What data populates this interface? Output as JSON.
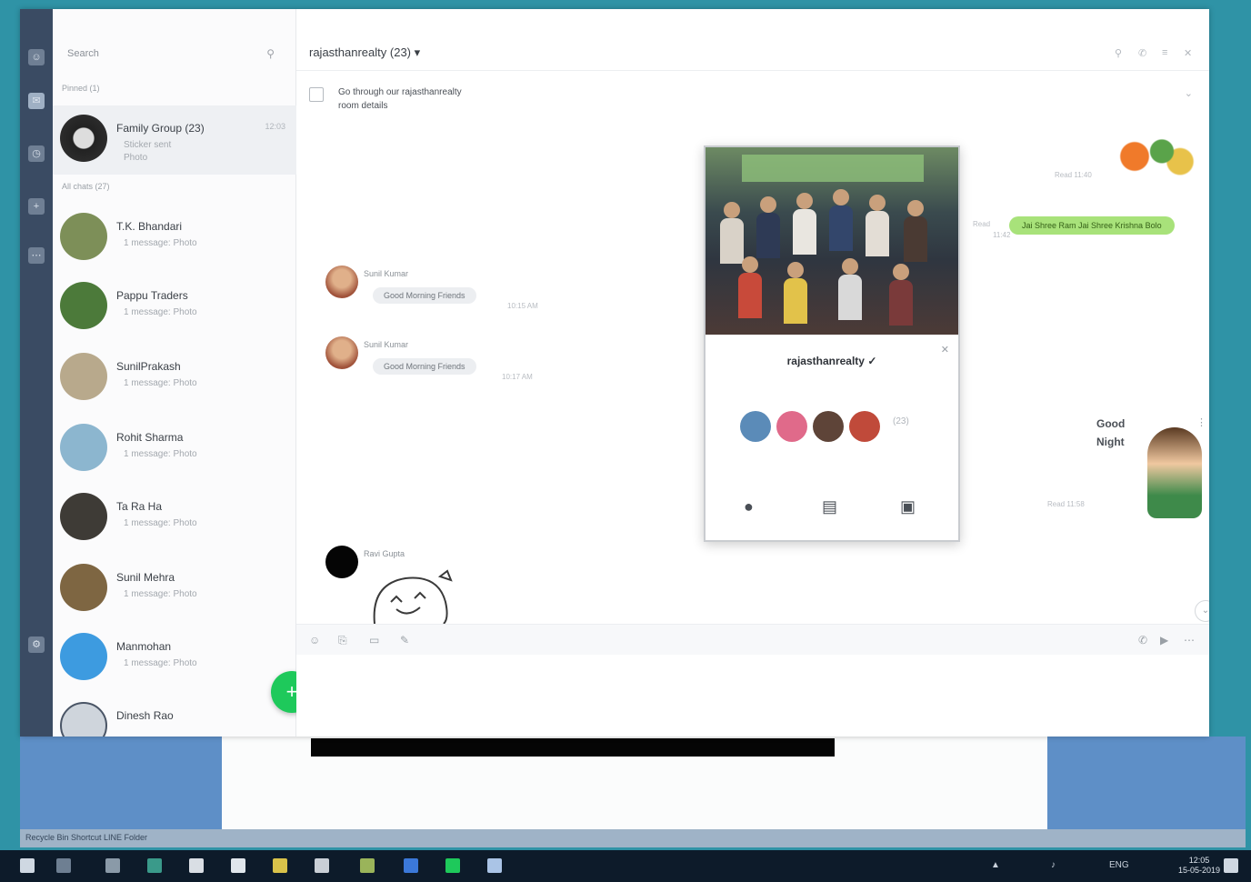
{
  "app": {
    "search_placeholder": "Search",
    "section_pinned": "Pinned (1)",
    "section_all": "All chats (27)",
    "new_chat_label": "+",
    "colors": {
      "rail": "#3a4b63",
      "accent_green": "#1ec95b",
      "sent_bubble": "#a8e27a"
    }
  },
  "pinned_chat": {
    "name": "Family Group (23)",
    "preview": "Sticker sent",
    "preview2": "Photo",
    "time": "12:03"
  },
  "chats": [
    {
      "name": "T.K. Bhandari",
      "preview": "1 message: Photo",
      "color": "#7d8f58"
    },
    {
      "name": "Pappu Traders",
      "preview": "1 message: Photo",
      "color": "#4c7a3a"
    },
    {
      "name": "SunilPrakash",
      "preview": "1 message: Photo",
      "color": "#b8a98c"
    },
    {
      "name": "Rohit Sharma",
      "preview": "1 message: Photo",
      "color": "#8cb6cf"
    },
    {
      "name": "Ta Ra Ha",
      "preview": "1 message: Photo",
      "color": "#3e3b36"
    },
    {
      "name": "Sunil Mehra",
      "preview": "1 message: Photo",
      "color": "#7e6642"
    },
    {
      "name": "Manmohan",
      "preview": "1 message: Photo",
      "color": "#3d9be0"
    },
    {
      "name": "Dinesh Rao",
      "preview": "",
      "color": "#cfd5dc"
    }
  ],
  "conversation": {
    "title": "rajasthanrealty (23) ▾",
    "announcement_line1": "Go through our rajasthanrealty",
    "announcement_line2": "room details",
    "messages": [
      {
        "sender": "Sunil Kumar",
        "text": "Good Morning Friends",
        "time": "10:15 AM"
      },
      {
        "sender": "Sunil Kumar",
        "text": "Good Morning Friends",
        "time": "10:17 AM"
      },
      {
        "sender": "Ravi Gupta",
        "text": ""
      }
    ],
    "mine": {
      "text": "Jai Shree Ram Jai Shree Krishna Bolo",
      "read": "Read",
      "time": "11:42"
    },
    "sticker_meta_1": "Read 11:40",
    "sticker_meta_2": "Read 11:58",
    "sticker_text": "Good Night"
  },
  "popup": {
    "name": "rajasthanrealty",
    "name_suffix": "✓",
    "more_members": "(23)",
    "actions": [
      "chat",
      "notes",
      "album"
    ]
  },
  "desktop": {
    "strip_text": "Recycle Bin   Shortcut   LINE   Folder"
  },
  "taskbar": {
    "clock_time": "12:05",
    "clock_date": "15-05-2019",
    "tray": "ENG"
  }
}
